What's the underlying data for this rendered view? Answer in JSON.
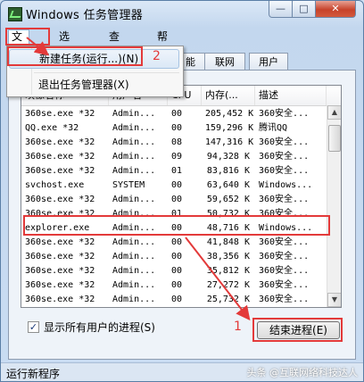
{
  "window": {
    "title": "Windows 任务管理器",
    "controls": {
      "minimize": "—",
      "maximize": "□",
      "close": "✕"
    }
  },
  "menubar": [
    {
      "label": "文件(F)"
    },
    {
      "label": "选项(O)"
    },
    {
      "label": "查看(V)"
    },
    {
      "label": "帮助(H)"
    }
  ],
  "file_menu": {
    "items": [
      {
        "label": "新建任务(运行...)(N)"
      },
      {
        "label": "退出任务管理器(X)"
      }
    ]
  },
  "tabs": [
    {
      "label": "能"
    },
    {
      "label": "联网"
    },
    {
      "label": "用户"
    }
  ],
  "columns": [
    {
      "label": "映像名称"
    },
    {
      "label": "用户名"
    },
    {
      "label": "CPU"
    },
    {
      "label": "内存(..."
    },
    {
      "label": "描述"
    }
  ],
  "rows": [
    [
      "360se.exe *32",
      "Admin...",
      "00",
      "205,452 K",
      "360安全..."
    ],
    [
      "QQ.exe *32",
      "Admin...",
      "00",
      "159,296 K",
      "腾讯QQ"
    ],
    [
      "360se.exe *32",
      "Admin...",
      "08",
      "147,316 K",
      "360安全..."
    ],
    [
      "360se.exe *32",
      "Admin...",
      "09",
      "94,328 K",
      "360安全..."
    ],
    [
      "360se.exe *32",
      "Admin...",
      "01",
      "83,816 K",
      "360安全..."
    ],
    [
      "svchost.exe",
      "SYSTEM",
      "00",
      "63,640 K",
      "Windows..."
    ],
    [
      "360se.exe *32",
      "Admin...",
      "00",
      "59,652 K",
      "360安全..."
    ],
    [
      "360se.exe *32",
      "Admin...",
      "01",
      "50,732 K",
      "360安全..."
    ],
    [
      "explorer.exe",
      "Admin...",
      "00",
      "48,716 K",
      "Windows..."
    ],
    [
      "360se.exe *32",
      "Admin...",
      "00",
      "41,848 K",
      "360安全..."
    ],
    [
      "360se.exe *32",
      "Admin...",
      "00",
      "38,356 K",
      "360安全..."
    ],
    [
      "360se.exe *32",
      "Admin...",
      "00",
      "35,812 K",
      "360安全..."
    ],
    [
      "360se.exe *32",
      "Admin...",
      "00",
      "27,272 K",
      "360安全..."
    ],
    [
      "360se.exe *32",
      "Admin...",
      "00",
      "25,732 K",
      "360安全..."
    ],
    [
      "360se.exe *32",
      "Admin...",
      "00",
      "22,672 K",
      "360安全..."
    ]
  ],
  "show_all_users": {
    "label": "显示所有用户的进程(S)",
    "checked": true,
    "mark": "✓"
  },
  "end_process_button": {
    "label": "结束进程(E)"
  },
  "status_bar": {
    "text": "运行新程序"
  },
  "watermark": "头条 @互联网络科技达人",
  "annotations": {
    "step1": "1",
    "step2": "2",
    "color": "#e33a3a"
  },
  "scrollbar": {
    "up": "▲",
    "down": "▼"
  }
}
